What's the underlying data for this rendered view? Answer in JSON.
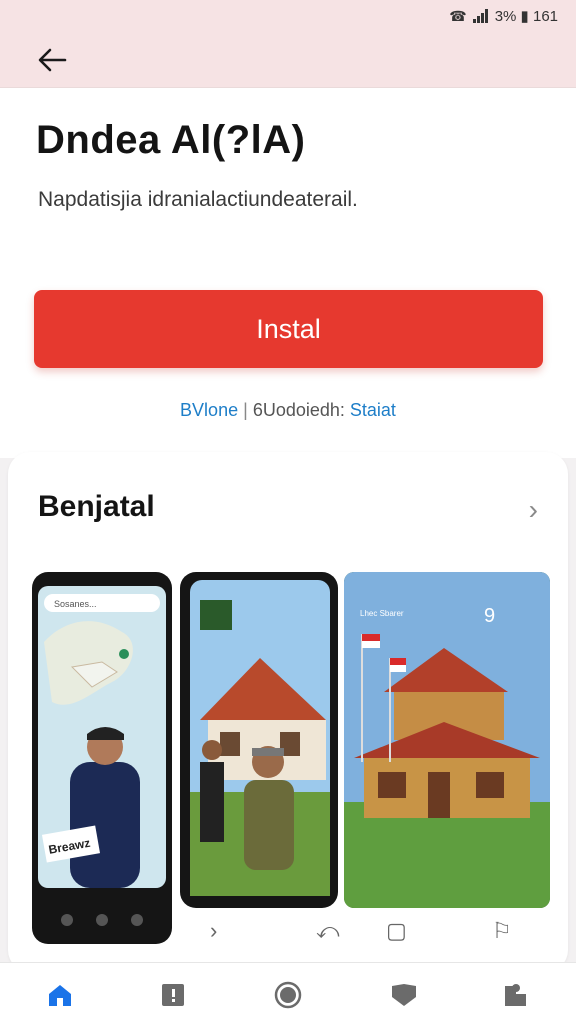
{
  "status": {
    "text": "3% ▮ 161"
  },
  "app": {
    "title": "Dndea Al(?lA)",
    "description": "Napdatisjia idranialactiundeaterail."
  },
  "install": {
    "label": "Instal"
  },
  "meta": {
    "left": "BVlone",
    "separator": "|",
    "middle": "6Uodoiedh:",
    "right": "Staiat"
  },
  "screenshots": {
    "title": "Benjatal",
    "shot1_banner": "Breawz",
    "shot1_search": "Sosanes...",
    "shot3_time": "9",
    "shot3_label": "Lhec Sbarer"
  },
  "colors": {
    "accent": "#e6392f",
    "link": "#1e7ec8",
    "header": "#f6e3e4",
    "nav_active": "#1a73e8"
  },
  "bottom_nav": [
    "home-icon",
    "news-icon",
    "record-icon",
    "heart-icon",
    "puzzle-icon"
  ]
}
